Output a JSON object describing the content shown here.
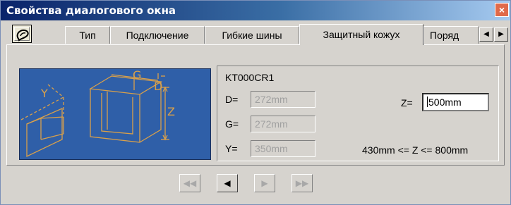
{
  "window": {
    "title": "Свойства диалогового окна",
    "close_symbol": "×"
  },
  "tabs": [
    {
      "label": "Тип",
      "active": false
    },
    {
      "label": "Подключение",
      "active": false
    },
    {
      "label": "Гибкие шины",
      "active": false
    },
    {
      "label": "Защитный кожух",
      "active": true
    },
    {
      "label": "Поряд",
      "active": false
    }
  ],
  "tab_scroll": {
    "left_icon": "◀",
    "right_icon": "▶"
  },
  "diagram": {
    "labels": {
      "y": "Y",
      "g": "G",
      "d": "D",
      "z": "Z"
    },
    "colors": {
      "background": "#2f5fa8",
      "lines": "#d9a04a"
    }
  },
  "params": {
    "code": "KT000CR1",
    "d": {
      "label": "D=",
      "value": "272mm"
    },
    "g": {
      "label": "G=",
      "value": "272mm"
    },
    "y": {
      "label": "Y=",
      "value": "350mm"
    },
    "z": {
      "label": "Z=",
      "value": "500mm"
    },
    "range": "430mm <= Z <= 800mm"
  },
  "nav": {
    "first": "◀◀",
    "prev": "◀",
    "next": "▶",
    "last": "▶▶"
  }
}
